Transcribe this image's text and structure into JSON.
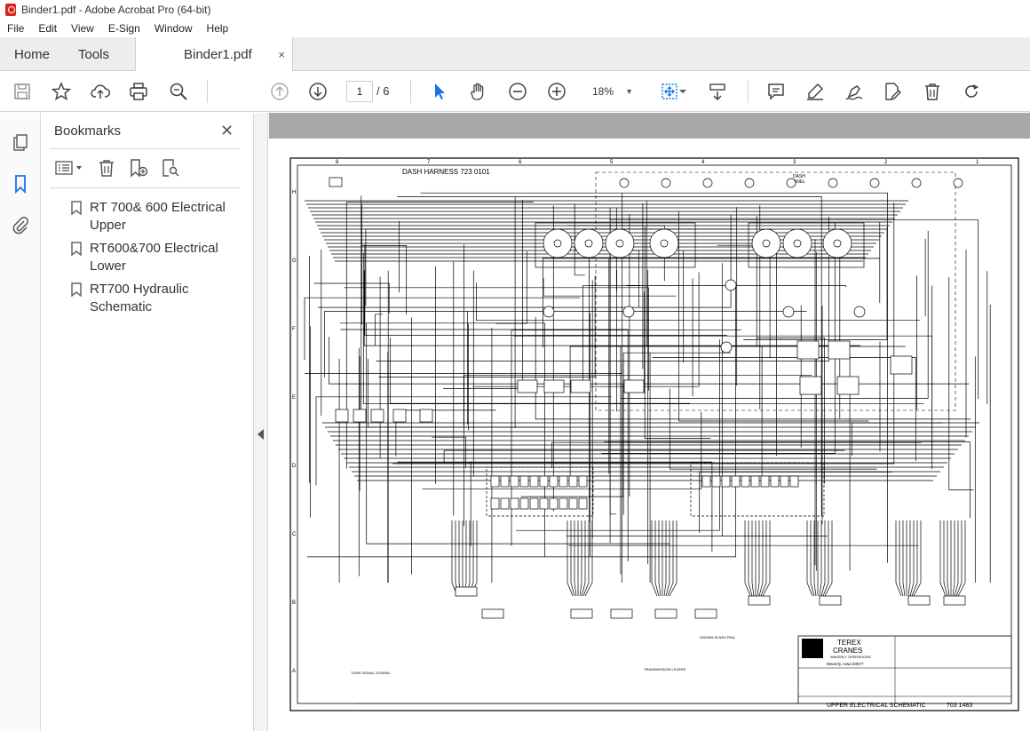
{
  "window": {
    "title": "Binder1.pdf - Adobe Acrobat Pro (64-bit)"
  },
  "menu": {
    "items": [
      "File",
      "Edit",
      "View",
      "E-Sign",
      "Window",
      "Help"
    ]
  },
  "tabs": {
    "home": "Home",
    "tools": "Tools",
    "document": "Binder1.pdf",
    "close": "×"
  },
  "toolbar": {
    "page_current": "1",
    "page_total": "/ 6",
    "zoom": "18%"
  },
  "bookmarks": {
    "title": "Bookmarks",
    "close": "✕",
    "items": [
      {
        "line1": "RT 700& 600 Electrical",
        "line2": "Upper"
      },
      {
        "line1": "RT600&700 Electrical",
        "line2": "Lower"
      },
      {
        "line1": "RT700 Hydraulic",
        "line2": "Schematic"
      }
    ]
  },
  "schematic": {
    "heading": "DASH HARNESS 723 0101",
    "dash_panel": "DASH\nPANEL",
    "company_line1": "TEREX",
    "company_line2": "CRANES",
    "company_line3": "WAVERLY OPERATIONS",
    "location": "Waverly, Iowa 50677",
    "sheet_title": "UPPER ELECTRICAL SCHEMATIC",
    "drawing_number": "703 1483",
    "column_numbers": [
      "8",
      "7",
      "6",
      "5",
      "4",
      "3",
      "2",
      "1"
    ],
    "row_letters": [
      "H",
      "G",
      "F",
      "E",
      "D",
      "C",
      "B",
      "A"
    ],
    "turn_signal_legend": "TURN SIGNAL LEGEND",
    "transmission_legend": "TRANSMISSION LEVERS",
    "shown_in_neutral": "SHOWN IN NEUTRAL"
  },
  "colors": {
    "accent": "#1a73e8",
    "graybar": "#a8a8a8"
  }
}
